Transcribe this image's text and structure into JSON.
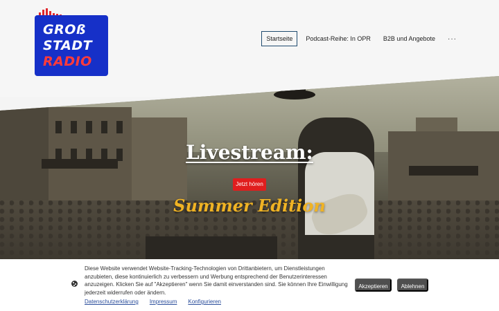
{
  "logo": {
    "line1": "GROß",
    "line2": "STADT",
    "line3": "RADIO",
    "colors": {
      "box": "#1630c8",
      "accent": "#ff3b3b",
      "bars": "#e0262b"
    }
  },
  "nav": {
    "items": [
      {
        "label": "Startseite",
        "active": true
      },
      {
        "label": "Podcast-Reihe: In OPR",
        "active": false
      },
      {
        "label": "B2B und Angebote",
        "active": false
      }
    ],
    "more_label": "···"
  },
  "hero": {
    "title": "Livestream:",
    "button_label": "Jetzt hören",
    "subtitle": "Summer Edition",
    "colors": {
      "button": "#e01e1e",
      "subtitle": "#f0b324"
    }
  },
  "cookie_banner": {
    "text": "Diese Website verwendet Website-Tracking-Technologien von Drittanbietern, um Dienstleistungen anzubieten, diese kontinuierlich zu verbessern und Werbung entsprechend der Benutzerinteressen anzuzeigen. Klicken Sie auf \"Akzeptieren\" wenn Sie damit einverstanden sind. Sie können Ihre Einwilligung jederzeit widerrufen oder ändern.",
    "links": [
      "Datenschutzerklärung",
      "Impressum",
      "Konfigurieren"
    ],
    "accept_label": "Akzeptieren",
    "reject_label": "Ablehnen",
    "icon": "cookie-icon"
  }
}
